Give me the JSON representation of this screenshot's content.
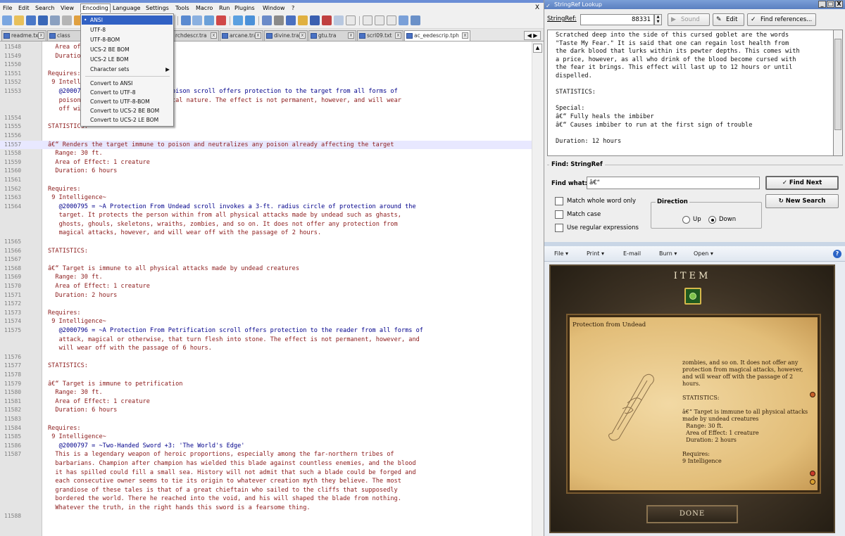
{
  "npp": {
    "menus": [
      "File",
      "Edit",
      "Search",
      "View",
      "Encoding",
      "Language",
      "Settings",
      "Tools",
      "Macro",
      "Run",
      "Plugins",
      "Window",
      "?"
    ],
    "close_x": "X",
    "tabs": [
      "readme.txt",
      "class",
      "rchdescr.tra",
      "arcane.tra",
      "divine.tra",
      "gtu.tra",
      "scrl09.txt",
      "ac_eedescrip.tph"
    ],
    "encoding_menu": {
      "items": [
        "ANSI",
        "UTF-8",
        "UTF-8-BOM",
        "UCS-2 BE BOM",
        "UCS-2 LE BOM",
        "Character sets"
      ],
      "convert_items": [
        "Convert to ANSI",
        "Convert to UTF-8",
        "Convert to UTF-8-BOM",
        "Convert to UCS-2 BE BOM",
        "Convert to UCS-2 LE BOM"
      ],
      "selected_bullet": "•",
      "submenu_arrow": "▶"
    },
    "lines": [
      {
        "n": "11548",
        "t": "Area of Effect: 1 creature",
        "indent": 2
      },
      {
        "n": "11549",
        "t": "Duration: 1 hour",
        "indent": 2
      },
      {
        "n": "11550",
        "t": "",
        "indent": 0
      },
      {
        "n": "11551",
        "t": "Requires:",
        "indent": 0
      },
      {
        "n": "11552",
        "t": "9 Intelligence~",
        "indent": 1
      },
      {
        "n": "11553",
        "t": "@2000794 = ~A Protection From Poison scroll offers protection to the target from all forms of",
        "indent": 3,
        "ref": true
      },
      {
        "n": "",
        "t": "poison, whether natural or magical nature. The effect is not permanent, however, and will wear",
        "indent": 3
      },
      {
        "n": "",
        "t": "off with the passage of 1 hour.",
        "indent": 3
      },
      {
        "n": "11554",
        "t": "",
        "indent": 0
      },
      {
        "n": "11555",
        "t": "STATISTICS:",
        "indent": 0
      },
      {
        "n": "11556",
        "t": "",
        "indent": 0
      },
      {
        "n": "11557",
        "t": "â€“ Renders the target immune to poison and neutralizes any poison already affecting the target",
        "indent": 0,
        "hl": true
      },
      {
        "n": "11558",
        "t": "Range: 30 ft.",
        "indent": 2
      },
      {
        "n": "11559",
        "t": "Area of Effect: 1 creature",
        "indent": 2
      },
      {
        "n": "11560",
        "t": "Duration: 6 hours",
        "indent": 2
      },
      {
        "n": "11561",
        "t": "",
        "indent": 0
      },
      {
        "n": "11562",
        "t": "Requires:",
        "indent": 0
      },
      {
        "n": "11563",
        "t": "9 Intelligence~",
        "indent": 1
      },
      {
        "n": "11564",
        "t": "@2000795 = ~A Protection From Undead scroll invokes a 3-ft. radius circle of protection around the",
        "indent": 3,
        "ref": true
      },
      {
        "n": "",
        "t": "target. It protects the person within from all physical attacks made by undead such as ghasts,",
        "indent": 3
      },
      {
        "n": "",
        "t": "ghosts, ghouls, skeletons, wraiths, zombies, and so on. It does not offer any protection from",
        "indent": 3
      },
      {
        "n": "",
        "t": "magical attacks, however, and will wear off with the passage of 2 hours.",
        "indent": 3
      },
      {
        "n": "11565",
        "t": "",
        "indent": 0
      },
      {
        "n": "11566",
        "t": "STATISTICS:",
        "indent": 0
      },
      {
        "n": "11567",
        "t": "",
        "indent": 0
      },
      {
        "n": "11568",
        "t": "â€“ Target is immune to all physical attacks made by undead creatures",
        "indent": 0
      },
      {
        "n": "11569",
        "t": "Range: 30 ft.",
        "indent": 2
      },
      {
        "n": "11570",
        "t": "Area of Effect: 1 creature",
        "indent": 2
      },
      {
        "n": "11571",
        "t": "Duration: 2 hours",
        "indent": 2
      },
      {
        "n": "11572",
        "t": "",
        "indent": 0
      },
      {
        "n": "11573",
        "t": "Requires:",
        "indent": 0
      },
      {
        "n": "11574",
        "t": "9 Intelligence~",
        "indent": 1
      },
      {
        "n": "11575",
        "t": "@2000796 = ~A Protection From Petrification scroll offers protection to the reader from all forms of",
        "indent": 3,
        "ref": true
      },
      {
        "n": "",
        "t": "attack, magical or otherwise, that turn flesh into stone. The effect is not permanent, however, and",
        "indent": 3
      },
      {
        "n": "",
        "t": "will wear off with the passage of 6 hours.",
        "indent": 3
      },
      {
        "n": "11576",
        "t": "",
        "indent": 0
      },
      {
        "n": "11577",
        "t": "STATISTICS:",
        "indent": 0
      },
      {
        "n": "11578",
        "t": "",
        "indent": 0
      },
      {
        "n": "11579",
        "t": "â€“ Target is immune to petrification",
        "indent": 0
      },
      {
        "n": "11580",
        "t": "Range: 30 ft.",
        "indent": 2
      },
      {
        "n": "11581",
        "t": "Area of Effect: 1 creature",
        "indent": 2
      },
      {
        "n": "11582",
        "t": "Duration: 6 hours",
        "indent": 2
      },
      {
        "n": "11583",
        "t": "",
        "indent": 0
      },
      {
        "n": "11584",
        "t": "Requires:",
        "indent": 0
      },
      {
        "n": "11585",
        "t": "9 Intelligence~",
        "indent": 1
      },
      {
        "n": "11586",
        "t": "@2000797 = ~Two-Handed Sword +3: 'The World's Edge'",
        "indent": 3,
        "ref": true
      },
      {
        "n": "11587",
        "t": "This is a legendary weapon of heroic proportions, especially among the far-northern tribes of",
        "indent": 2
      },
      {
        "n": "",
        "t": "barbarians. Champion after champion has wielded this blade against countless enemies, and the blood",
        "indent": 2
      },
      {
        "n": "",
        "t": "it has spilled could fill a small sea. History will not admit that such a blade could be forged and",
        "indent": 2
      },
      {
        "n": "",
        "t": "each consecutive owner seems to tie its origin to whatever creation myth they believe. The most",
        "indent": 2
      },
      {
        "n": "",
        "t": "grandiose of these tales is that of a great chieftain who sailed to the cliffs that supposedly",
        "indent": 2
      },
      {
        "n": "",
        "t": "bordered the world. There he reached into the void, and his will shaped the blade from nothing.",
        "indent": 2
      },
      {
        "n": "",
        "t": "Whatever the truth, in the right hands this sword is a fearsome thing.",
        "indent": 2
      },
      {
        "n": "11588",
        "t": "",
        "indent": 0
      }
    ]
  },
  "srl": {
    "title": "StringRef Lookup",
    "title_icon": "✓",
    "ctl_min": "_",
    "ctl_max": "□",
    "ctl_close": "X",
    "stringref_label": "StringRef:",
    "stringref_value": "88331",
    "spin_up": "▲",
    "spin_down": "▼",
    "sound_label": "Sound",
    "sound_icon": "▶",
    "edit_label": "Edit",
    "edit_icon": "✎",
    "findref_label": "Find references...",
    "findref_icon": "✓",
    "text_lines": [
      "Scratched deep into the side of this cursed goblet are the words",
      "\"Taste My Fear.\" It is said that one can regain lost health from",
      "the dark blood that lurks within its pewter depths. This comes with",
      "a price, however, as all who drink of the blood become cursed with",
      "the fear it brings. This effect will last up to 12 hours or until",
      "dispelled.",
      "",
      "STATISTICS:",
      "",
      "Special:",
      "â€“ Fully heals the imbiber",
      "â€“ Causes imbiber to run at the first sign of trouble",
      "",
      "Duration: 12 hours"
    ],
    "find_group_label": "Find: StringRef",
    "find_what_label": "Find what:",
    "find_value": "â€“",
    "find_next_label": "Find Next",
    "find_next_icon": "✓",
    "new_search_label": "New Search",
    "new_search_icon": "↻",
    "opt_whole_word": "Match whole word only",
    "opt_case": "Match case",
    "opt_regex": "Use regular expressions",
    "direction_label": "Direction",
    "dir_up": "Up",
    "dir_down": "Down"
  },
  "ie": {
    "cmds": [
      "File",
      "Print",
      "E-mail",
      "Burn",
      "Open"
    ],
    "caret": "▾",
    "help": "?",
    "game": {
      "header": "ITEM",
      "title": "Protection from Undead",
      "text_lines": [
        "zombies, and so on. It does not offer any",
        "protection from magical attacks, however,",
        "and will wear off with the passage of 2",
        "hours.",
        "",
        "STATISTICS:",
        "",
        "â€“ Target is immune to all physical attacks",
        "made by undead creatures",
        "  Range: 30 ft.",
        "  Area of Effect: 1 creature",
        "  Duration: 2 hours",
        "",
        "Requires:",
        "9 Intelligence"
      ],
      "done_label": "DONE"
    }
  },
  "colors": {
    "code_text": "#8b1a1a",
    "code_ref": "#00008b",
    "menu_highlight": "#3161c4",
    "parchment": "#e2bd78"
  }
}
